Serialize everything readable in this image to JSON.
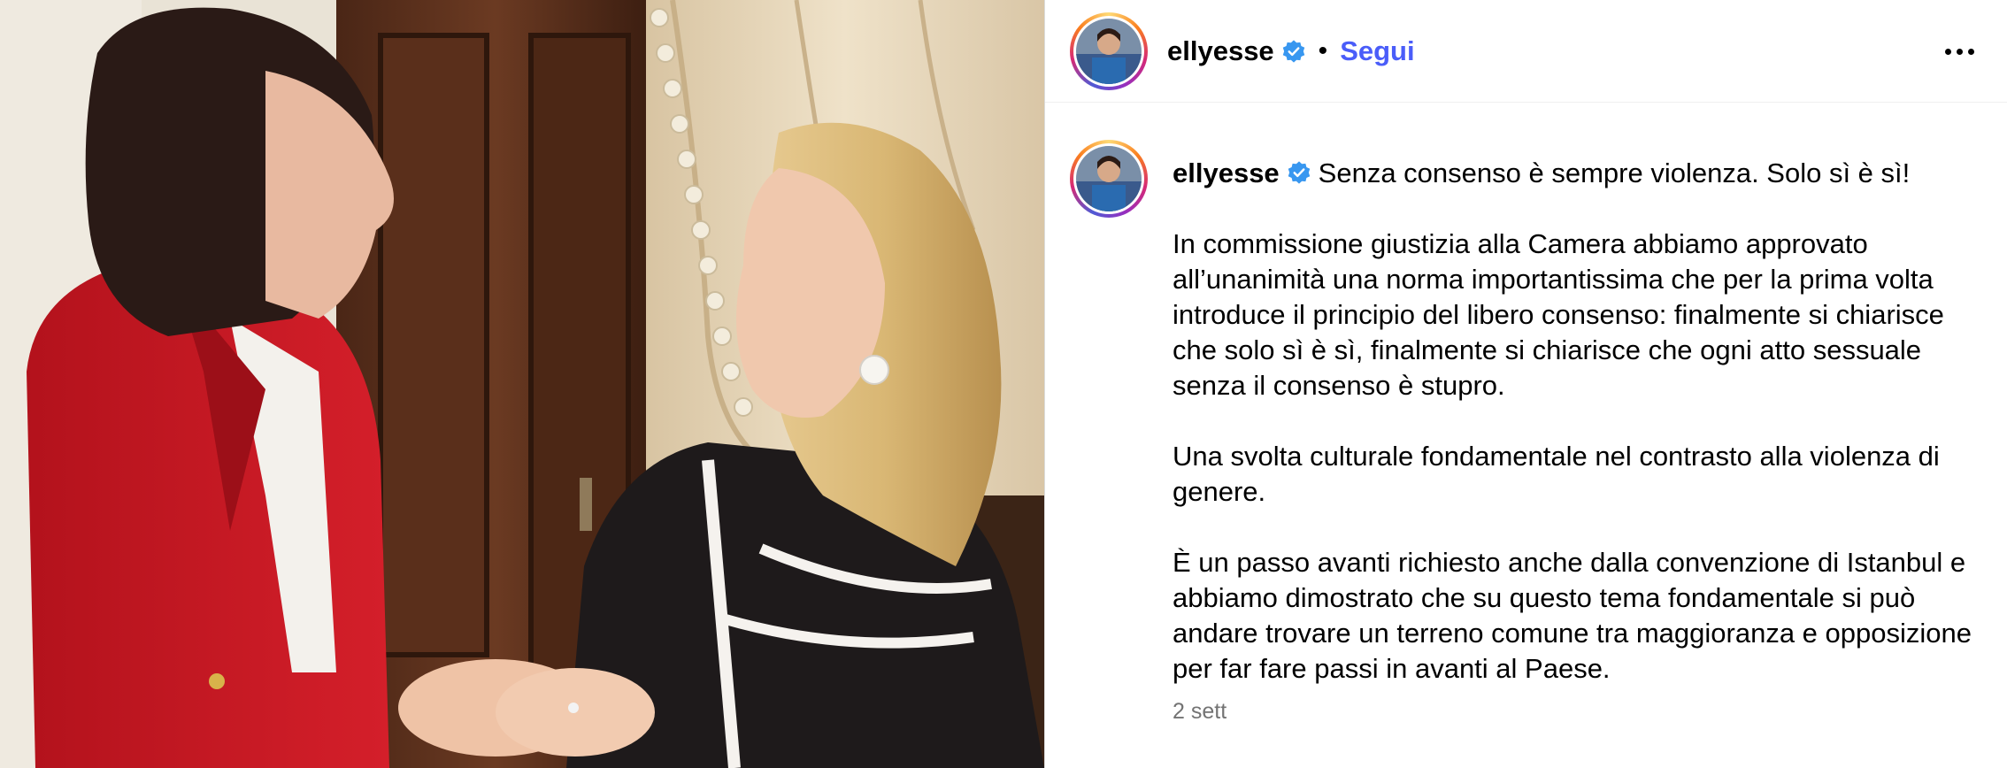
{
  "header": {
    "username": "ellyesse",
    "separator": "•",
    "follow_label": "Segui",
    "more_icon": "more-horizontal-icon"
  },
  "caption": {
    "username": "ellyesse",
    "first_line": "Senza consenso è sempre violenza. Solo sì è sì!",
    "paragraphs": [
      "In commissione giustizia alla Camera abbiamo approvato all’unanimità una norma importantissima che per la prima volta introduce il principio del libero consenso: finalmente si chiarisce che solo sì è sì, finalmente si chiarisce che ogni atto sessuale senza il consenso è stupro.",
      "Una svolta culturale fondamentale nel contrasto alla violenza di genere.",
      "È un passo avanti richiesto anche dalla convenzione di Istanbul e abbiamo dimostrato che su questo tema fondamentale si può andare trovare un terreno comune tra maggioranza e opposizione per far fare passi in avanti al Paese."
    ],
    "timestamp": "2 sett"
  },
  "colors": {
    "follow_blue": "#4a5df9",
    "verified_blue": "#3897f0",
    "timestamp_gray": "#737373"
  }
}
